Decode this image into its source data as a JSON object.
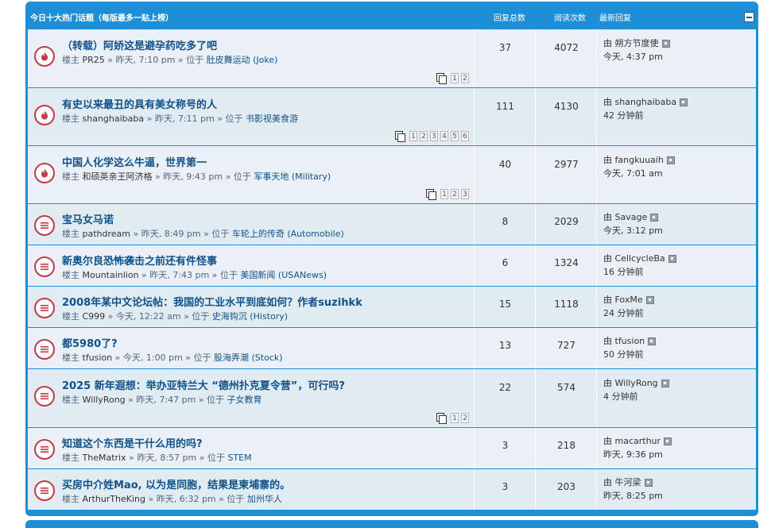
{
  "header": {
    "title": "今日十大热门话题（每版最多一贴上榜）",
    "col_replies": "回复总数",
    "col_views": "阅读次数",
    "col_last": "最新回复"
  },
  "labels": {
    "author_prefix": "楼主",
    "in_prefix": "位于",
    "by_prefix": "由"
  },
  "colors": {
    "accent": "#1e8fd6",
    "title": "#105289",
    "icon_border": "#c23a48"
  },
  "topics": [
    {
      "title": "（转载）阿娇这是避孕药吃多了吧",
      "author": "PR25",
      "time": "昨天, 7:10 pm",
      "forum": "肚皮舞运动 (Joke)",
      "hot": true,
      "pages": [
        "1",
        "2"
      ],
      "replies": "37",
      "views": "4072",
      "last_author": "朔方节度使",
      "last_time": "今天, 4:37 pm"
    },
    {
      "title": "有史以来最丑的具有美女称号的人",
      "author": "shanghaibaba",
      "time": "昨天, 7:11 pm",
      "forum": "书影视美食游",
      "hot": true,
      "pages": [
        "1",
        "2",
        "3",
        "4",
        "5",
        "6"
      ],
      "replies": "111",
      "views": "4130",
      "last_author": "shanghaibaba",
      "last_time": "42 分钟前"
    },
    {
      "title": "中国人化学这么牛逼，世界第一",
      "author": "和硕英亲王阿济格",
      "time": "昨天, 9:43 pm",
      "forum": "军事天地 (Military)",
      "hot": true,
      "pages": [
        "1",
        "2",
        "3"
      ],
      "replies": "40",
      "views": "2977",
      "last_author": "fangkuuaih",
      "last_time": "今天, 7:01 am"
    },
    {
      "title": "宝马女马诺",
      "author": "pathdream",
      "time": "昨天, 8:49 pm",
      "forum": "车轮上的传奇 (Automobile)",
      "hot": false,
      "pages": [],
      "replies": "8",
      "views": "2029",
      "last_author": "Savage",
      "last_time": "今天, 3:12 pm"
    },
    {
      "title": "新奥尔良恐怖袭击之前还有件怪事",
      "author": "Mountainlion",
      "time": "昨天, 7:43 pm",
      "forum": "美国新闻 (USANews)",
      "hot": false,
      "pages": [],
      "replies": "6",
      "views": "1324",
      "last_author": "CellcycleBa",
      "last_time": "16 分钟前"
    },
    {
      "title": "2008年某中文论坛帖：我国的工业水平到底如何？作者suzihkk",
      "author": "C999",
      "time": "今天, 12:22 am",
      "forum": "史海钩沉 (History)",
      "hot": false,
      "pages": [],
      "replies": "15",
      "views": "1118",
      "last_author": "FoxMe",
      "last_time": "24 分钟前"
    },
    {
      "title": "都5980了?",
      "author": "tfusion",
      "time": "今天, 1:00 pm",
      "forum": "股海弄潮 (Stock)",
      "hot": false,
      "pages": [],
      "replies": "13",
      "views": "727",
      "last_author": "tfusion",
      "last_time": "50 分钟前"
    },
    {
      "title": "2025 新年遐想：举办亚特兰大 “德州扑克夏令营”，可行吗?",
      "author": "WillyRong",
      "time": "昨天, 7:47 pm",
      "forum": "子女教育",
      "hot": false,
      "pages": [
        "1",
        "2"
      ],
      "replies": "22",
      "views": "574",
      "last_author": "WillyRong",
      "last_time": "4 分钟前"
    },
    {
      "title": "知道这个东西是干什么用的吗?",
      "author": "TheMatrix",
      "time": "昨天, 8:57 pm",
      "forum": "STEM",
      "hot": false,
      "pages": [],
      "replies": "3",
      "views": "218",
      "last_author": "macarthur",
      "last_time": "昨天, 9:36 pm"
    },
    {
      "title": "买房中介姓Mao, 以为是同胞，结果是柬埔寨的。",
      "author": "ArthurTheKing",
      "time": "昨天, 6:32 pm",
      "forum": "加州华人",
      "hot": false,
      "pages": [],
      "replies": "3",
      "views": "203",
      "last_author": "牛河梁",
      "last_time": "昨天, 8:25 pm"
    }
  ]
}
